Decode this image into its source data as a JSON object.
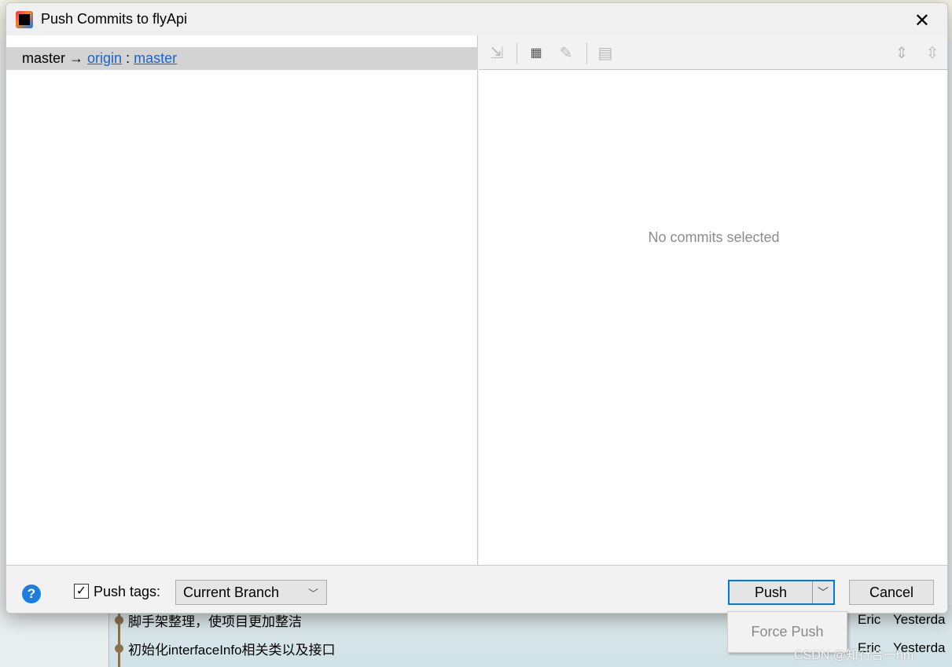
{
  "dialog": {
    "title": "Push Commits to flyApi",
    "close_icon": "close-icon"
  },
  "branch": {
    "local": "master",
    "arrow": "→",
    "remote": "origin",
    "separator": ":",
    "remote_branch": "master"
  },
  "details": {
    "empty_text": "No commits selected"
  },
  "footer": {
    "push_tags_checked": true,
    "push_tags_label": "Push tags:",
    "tags_select": "Current Branch",
    "push_label": "Push",
    "cancel_label": "Cancel",
    "force_push_label": "Force Push"
  },
  "background_log": [
    {
      "message": "脚手架整理，使项目更加整洁",
      "author": "Eric",
      "date": "Yesterda"
    },
    {
      "message": "初始化interfaceInfo相关类以及接口",
      "author": "Eric",
      "date": "Yesterda"
    }
  ],
  "watermark": "CSDN @知行合一hm"
}
